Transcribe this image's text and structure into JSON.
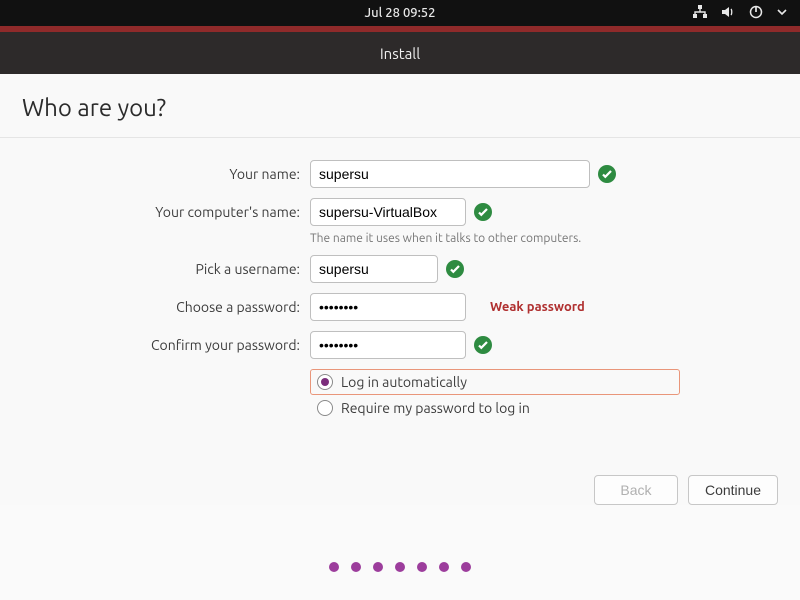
{
  "topbar": {
    "datetime": "Jul 28  09:52"
  },
  "window": {
    "title": "Install"
  },
  "page": {
    "heading": "Who are you?",
    "labels": {
      "name": "Your name:",
      "computer": "Your computer's name:",
      "computer_hint": "The name it uses when it talks to other computers.",
      "username": "Pick a username:",
      "password": "Choose a password:",
      "confirm": "Confirm your password:"
    },
    "values": {
      "name": "supersu",
      "computer": "supersu-VirtualBox",
      "username": "supersu",
      "password": "••••••••",
      "confirm": "••••••••"
    },
    "password_strength": "Weak password",
    "login_options": {
      "auto": "Log in automatically",
      "require": "Require my password to log in"
    },
    "buttons": {
      "back": "Back",
      "continue": "Continue"
    }
  }
}
